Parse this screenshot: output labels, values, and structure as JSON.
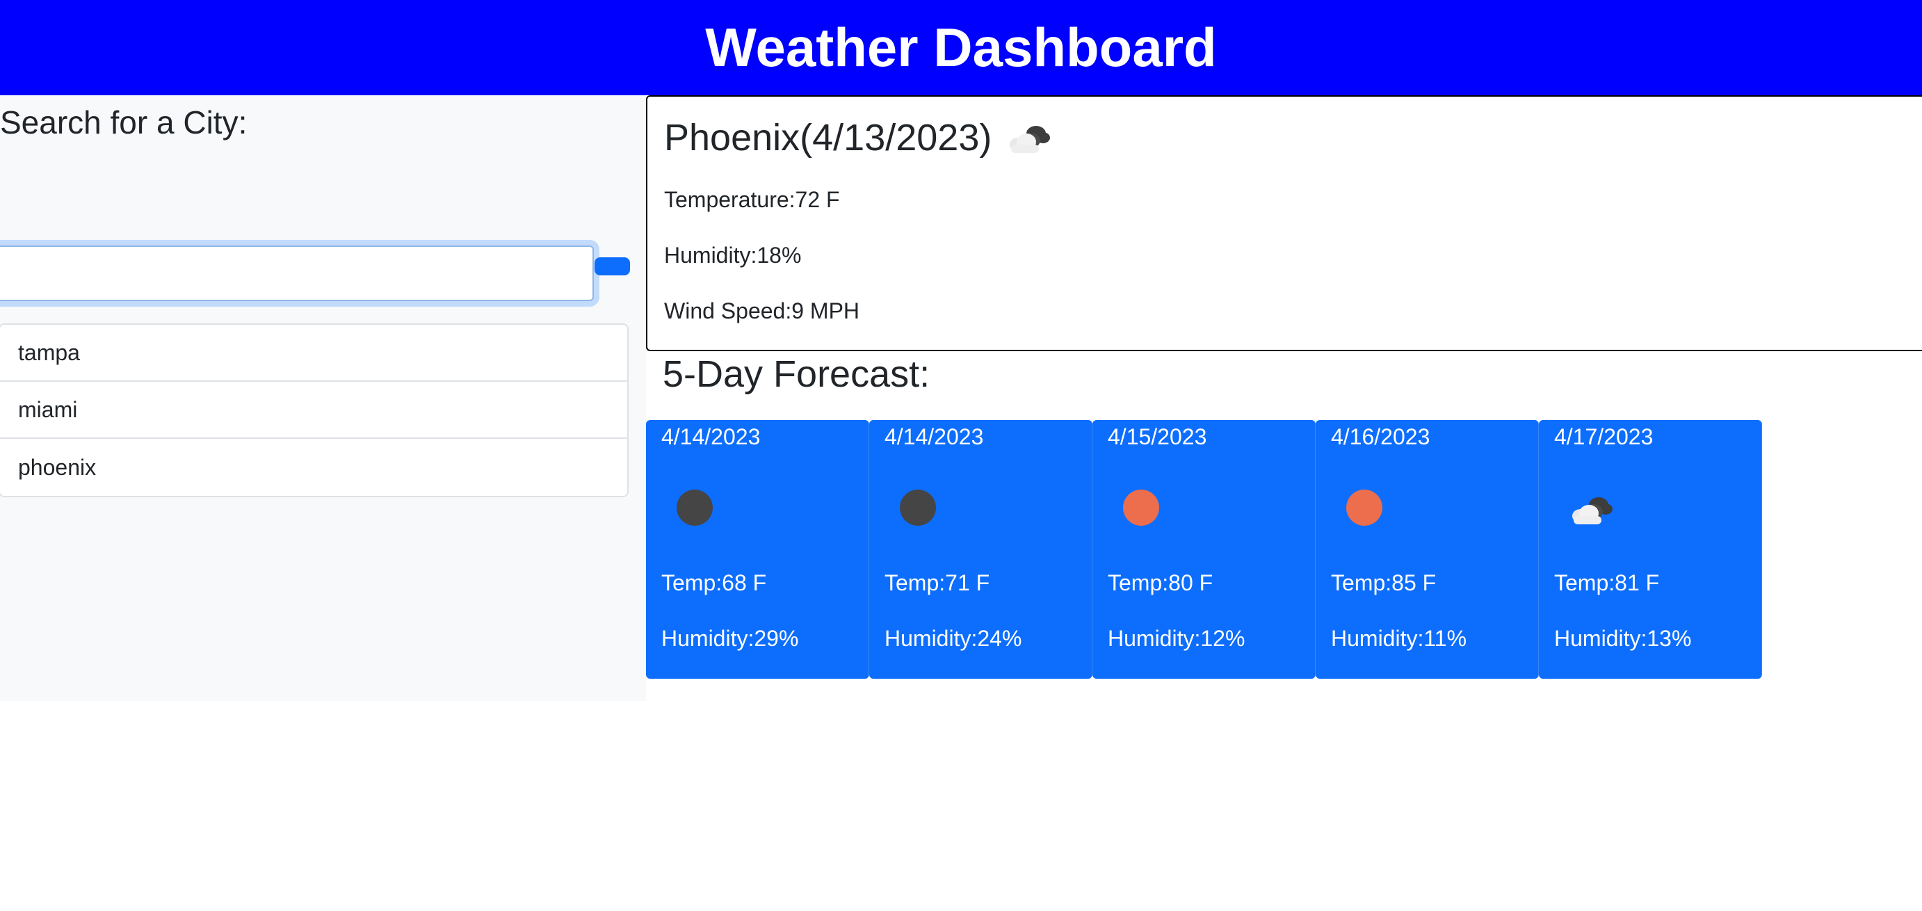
{
  "header": {
    "title": "Weather Dashboard"
  },
  "search": {
    "label": "Search for a City:",
    "placeholder": "",
    "value": ""
  },
  "history": [
    "tampa",
    "miami",
    "phoenix"
  ],
  "current": {
    "title": "Phoenix(4/13/2023)",
    "icon": "partly-cloudy-icon",
    "temperature": "Temperature:72 F",
    "humidity": "Humidity:18%",
    "wind": "Wind Speed:9 MPH"
  },
  "forecast": {
    "heading": "5-Day Forecast:",
    "days": [
      {
        "date": "4/14/2023",
        "icon": "moon-icon",
        "temp": "Temp:68 F",
        "humidity": "Humidity:29%"
      },
      {
        "date": "4/14/2023",
        "icon": "moon-icon",
        "temp": "Temp:71 F",
        "humidity": "Humidity:24%"
      },
      {
        "date": "4/15/2023",
        "icon": "sun-icon",
        "temp": "Temp:80 F",
        "humidity": "Humidity:12%"
      },
      {
        "date": "4/16/2023",
        "icon": "sun-icon",
        "temp": "Temp:85 F",
        "humidity": "Humidity:11%"
      },
      {
        "date": "4/17/2023",
        "icon": "partly-cloudy-icon",
        "temp": "Temp:81 F",
        "humidity": "Humidity:13%"
      }
    ]
  },
  "colors": {
    "header_bg": "#0000ff",
    "card_bg": "#0d6efd",
    "sun": "#ec6e4c",
    "moon": "#454545"
  }
}
